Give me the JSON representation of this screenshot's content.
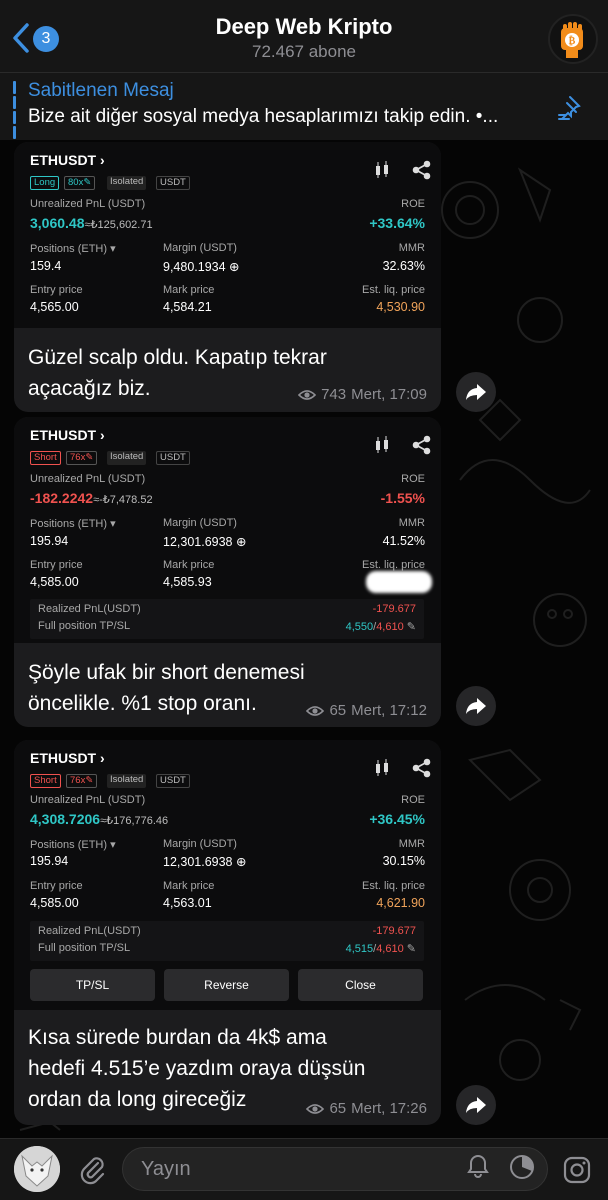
{
  "header": {
    "back_count": "3",
    "title": "Deep Web Kripto",
    "subtitle": "72.467 abone"
  },
  "pinned": {
    "title": "Sabitlenen Mesaj",
    "text": "Bize ait diğer sosyal medya hesaplarımızı takip edin. •..."
  },
  "messages": [
    {
      "card": {
        "pair": "ETHUSDT",
        "side": "Long",
        "leverage": "80x",
        "margin_mode": "Isolated",
        "quote": "USDT",
        "unrealized_label": "Unrealized PnL (USDT)",
        "unrealized": "3,060.48",
        "unrealized_approx": "≈₺125,602.71",
        "roe_label": "ROE",
        "roe": "+33.64%",
        "positions_label": "Positions (ETH)",
        "positions": "159.4",
        "margin_label": "Margin (USDT)",
        "margin": "9,480.1934",
        "mmr_label": "MMR",
        "mmr": "32.63%",
        "entry_label": "Entry price",
        "entry": "4,565.00",
        "mark_label": "Mark price",
        "mark": "4,584.21",
        "liq_label": "Est. liq. price",
        "liq": "4,530.90"
      },
      "caption_lines": [
        "Güzel scalp oldu. Kapatıp tekrar",
        "açacağız biz."
      ],
      "views": "743",
      "author_time": "Mert, 17:09"
    },
    {
      "card": {
        "pair": "ETHUSDT",
        "side": "Short",
        "leverage": "76x",
        "margin_mode": "Isolated",
        "quote": "USDT",
        "unrealized_label": "Unrealized PnL (USDT)",
        "unrealized": "-182.2242",
        "unrealized_approx": "≈-₺7,478.52",
        "roe_label": "ROE",
        "roe": "-1.55%",
        "positions_label": "Positions (ETH)",
        "positions": "195.94",
        "margin_label": "Margin (USDT)",
        "margin": "12,301.6938",
        "mmr_label": "MMR",
        "mmr": "41.52%",
        "entry_label": "Entry price",
        "entry": "4,585.00",
        "mark_label": "Mark price",
        "mark": "4,585.93",
        "liq_label": "Est. liq. price",
        "realized_label": "Realized PnL(USDT)",
        "realized": "-179.677",
        "tpsl_label": "Full position TP/SL",
        "tp": "4,550",
        "sl": "4,610"
      },
      "caption_lines": [
        "Şöyle ufak bir short denemesi",
        "öncelikle. %1 stop oranı."
      ],
      "views": "65",
      "author_time": "Mert, 17:12"
    },
    {
      "card": {
        "pair": "ETHUSDT",
        "side": "Short",
        "leverage": "76x",
        "margin_mode": "Isolated",
        "quote": "USDT",
        "unrealized_label": "Unrealized PnL (USDT)",
        "unrealized": "4,308.7206",
        "unrealized_approx": "≈₺176,776.46",
        "roe_label": "ROE",
        "roe": "+36.45%",
        "positions_label": "Positions (ETH)",
        "positions": "195.94",
        "margin_label": "Margin (USDT)",
        "margin": "12,301.6938",
        "mmr_label": "MMR",
        "mmr": "30.15%",
        "entry_label": "Entry price",
        "entry": "4,585.00",
        "mark_label": "Mark price",
        "mark": "4,563.01",
        "liq_label": "Est. liq. price",
        "liq": "4,621.90",
        "realized_label": "Realized PnL(USDT)",
        "realized": "-179.677",
        "tpsl_label": "Full position TP/SL",
        "tp": "4,515",
        "sl": "4,610",
        "btn_tpsl": "TP/SL",
        "btn_reverse": "Reverse",
        "btn_close": "Close"
      },
      "caption_lines": [
        "Kısa sürede burdan da 4k$ ama",
        "hedefi 4.515’e yazdım oraya düşsün",
        "ordan da long gireceğiz"
      ],
      "views": "65",
      "author_time": "Mert, 17:26"
    }
  ],
  "bottom": {
    "placeholder": "Yayın"
  },
  "colors": {
    "accent": "#3d8fe0",
    "profit": "#2fc7c6",
    "loss": "#f0524f",
    "liq": "#f0a35a",
    "bubble": "#1c1c1e"
  },
  "icons": [
    "back-chevron-icon",
    "pin-list-icon",
    "candlestick-icon",
    "share-icon",
    "views-eye-icon",
    "forward-icon",
    "attach-icon",
    "bell-icon",
    "timer-icon",
    "instagram-icon",
    "edit-icon",
    "add-circle-icon",
    "triangle-down-icon"
  ]
}
